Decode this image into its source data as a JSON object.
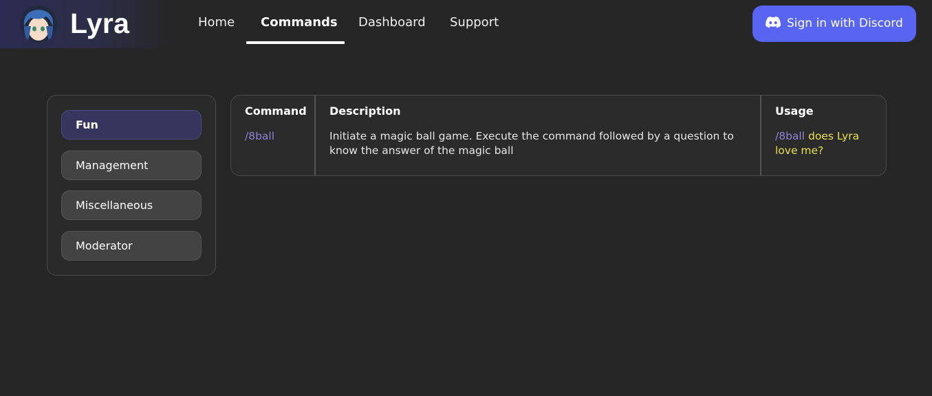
{
  "header": {
    "brand_name": "Lyra",
    "nav": [
      {
        "label": "Home",
        "active": false
      },
      {
        "label": "Commands",
        "active": true
      },
      {
        "label": "Dashboard",
        "active": false
      },
      {
        "label": "Support",
        "active": false
      }
    ],
    "login_button": {
      "label": "Sign in with Discord",
      "icon": "discord-icon",
      "color": "#5865f2"
    }
  },
  "sidebar": {
    "categories": [
      {
        "label": "Fun",
        "active": true
      },
      {
        "label": "Management",
        "active": false
      },
      {
        "label": "Miscellaneous",
        "active": false
      },
      {
        "label": "Moderator",
        "active": false
      }
    ]
  },
  "table": {
    "headers": {
      "command": "Command",
      "description": "Description",
      "usage": "Usage"
    },
    "rows": [
      {
        "command": "/8ball",
        "description": "Initiate a magic ball game. Execute the command followed by a question to know the answer of the magic ball",
        "usage_command": "/8ball",
        "usage_args": "does Lyra love me?"
      }
    ]
  },
  "colors": {
    "background": "#262626",
    "accent": "#5865f2",
    "active_category": "#35355d",
    "command_text": "#8f83d6",
    "usage_arg_text": "#e8e04a"
  }
}
